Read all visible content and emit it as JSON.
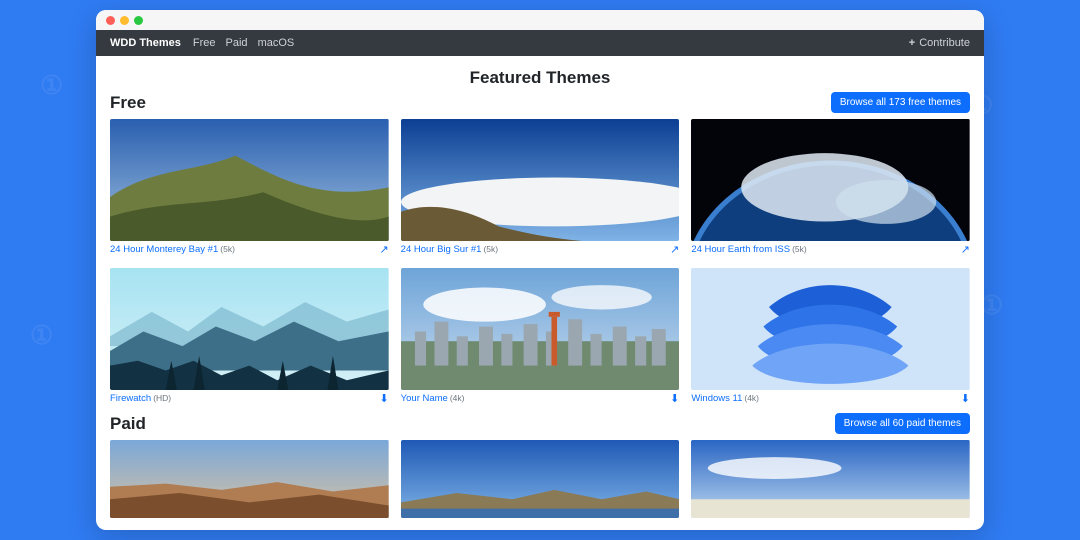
{
  "nav": {
    "brand": "WDD Themes",
    "links": [
      "Free",
      "Paid",
      "macOS"
    ],
    "contribute": "Contribute"
  },
  "page_title": "Featured Themes",
  "sections": {
    "free": {
      "heading": "Free",
      "browse_label": "Browse all 173 free themes",
      "cards": [
        {
          "title": "24 Hour Monterey Bay #1",
          "res": "(5k)",
          "action": "external"
        },
        {
          "title": "24 Hour Big Sur #1",
          "res": "(5k)",
          "action": "external"
        },
        {
          "title": "24 Hour Earth from ISS",
          "res": "(5k)",
          "action": "external"
        },
        {
          "title": "Firewatch",
          "res": "(HD)",
          "action": "download"
        },
        {
          "title": "Your Name",
          "res": "(4k)",
          "action": "download"
        },
        {
          "title": "Windows 11",
          "res": "(4k)",
          "action": "download"
        }
      ]
    },
    "paid": {
      "heading": "Paid",
      "browse_label": "Browse all 60 paid themes"
    }
  },
  "icons": {
    "external": "↗",
    "download": "⬇"
  }
}
